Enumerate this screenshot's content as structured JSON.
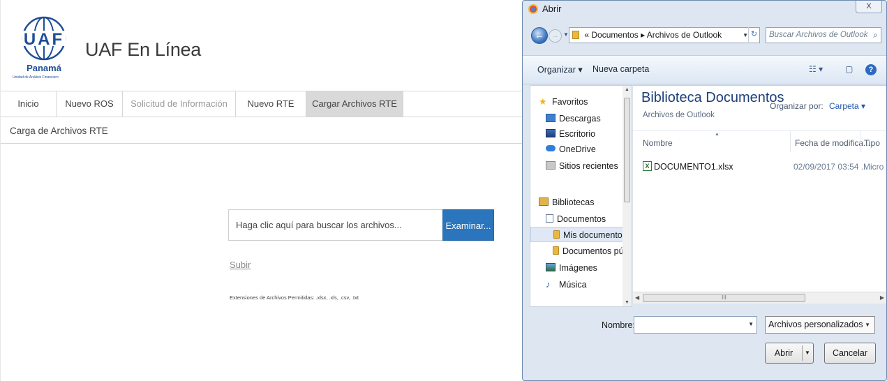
{
  "app": {
    "logo": {
      "letters": "UAF",
      "caption": "Panamá",
      "subcaption": "Unidad de Análisis Financiero"
    },
    "title": "UAF En Línea",
    "nav": [
      {
        "label": "Inicio",
        "state": "normal"
      },
      {
        "label": "Nuevo ROS",
        "state": "normal"
      },
      {
        "label": "Solicitud de Información",
        "state": "disabled"
      },
      {
        "label": "Nuevo RTE",
        "state": "normal"
      },
      {
        "label": "Cargar Archivos RTE",
        "state": "active"
      }
    ],
    "section_title": "Carga de Archivos RTE",
    "upload": {
      "placeholder": "Haga clic aquí para buscar los archivos...",
      "browse_label": "Examinar...",
      "submit_link": "Subir",
      "allowed_extensions": "Extensiones de Archivos Permitidas: .xlsx, .xls, .csv, .txt"
    },
    "colors": {
      "primary_button": "#2a75bb"
    }
  },
  "dialog": {
    "title": "Abrir",
    "close_label": "X",
    "address": {
      "prefix": "«",
      "segments": [
        "Documentos",
        "Archivos de Outlook"
      ]
    },
    "search_placeholder": "Buscar Archivos de Outlook",
    "toolbar": {
      "organize": "Organizar ▾",
      "new_folder": "Nueva carpeta",
      "views_icon": "☷ ▾",
      "preview_icon": "▢",
      "help": "?"
    },
    "nav_tree": [
      {
        "label": "Favoritos",
        "icon": "star-icon"
      },
      {
        "label": "Descargas",
        "icon": "downloads-icon"
      },
      {
        "label": "Escritorio",
        "icon": "desktop-icon"
      },
      {
        "label": "OneDrive",
        "icon": "onedrive-icon"
      },
      {
        "label": "Sitios recientes",
        "icon": "recent-icon"
      },
      {
        "label": "Bibliotecas",
        "icon": "libraries-icon"
      },
      {
        "label": "Documentos",
        "icon": "documents-icon"
      },
      {
        "label": "Mis documentos",
        "icon": "folder-icon",
        "selected": true
      },
      {
        "label": "Documentos públi",
        "icon": "folder-icon"
      },
      {
        "label": "Imágenes",
        "icon": "pictures-icon"
      },
      {
        "label": "Música",
        "icon": "music-icon"
      }
    ],
    "library": {
      "title": "Biblioteca Documentos",
      "subtitle": "Archivos de Outlook",
      "arrange_label": "Organizar por:",
      "arrange_value": "Carpeta ▾"
    },
    "columns": {
      "name": "Nombre",
      "date": "Fecha de modifica...",
      "type": "Tipo"
    },
    "files": [
      {
        "name": "DOCUMENTO1.xlsx",
        "date": "02/09/2017 03:54 ...",
        "type": "Micro",
        "icon": "excel-file-icon"
      }
    ],
    "hscroll_grip": "III",
    "filename_label": "Nombre:",
    "filename_value": "",
    "filetype_value": "Archivos personalizados",
    "open_label": "Abrir",
    "cancel_label": "Cancelar"
  }
}
